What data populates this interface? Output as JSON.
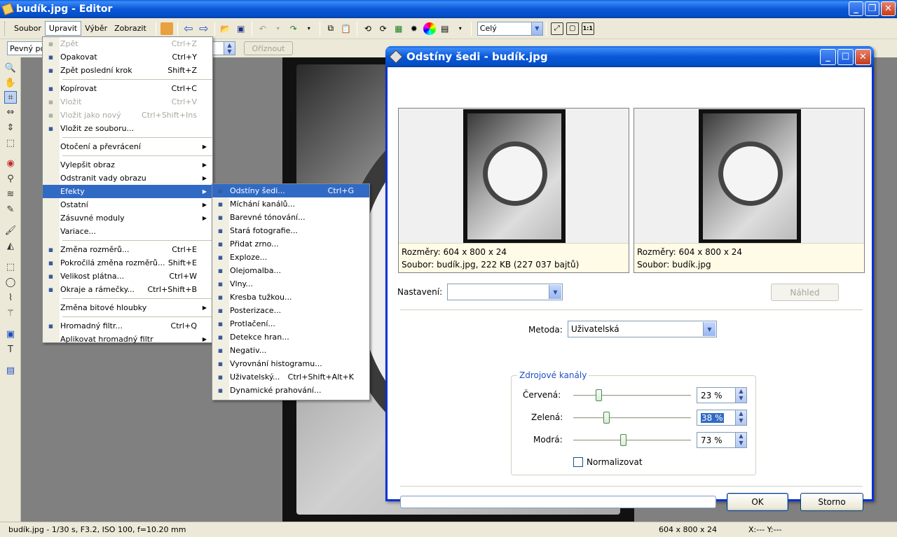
{
  "window": {
    "title": "budík.jpg - Editor"
  },
  "menubar": [
    "Soubor",
    "Upravit",
    "Výběr",
    "Zobrazit"
  ],
  "toolbar": {
    "zoom_value": "Celý",
    "ratio_value": "Pevný po",
    "crop_button": "Oříznout"
  },
  "edit_menu": [
    {
      "label": "Zpět",
      "shortcut": "Ctrl+Z",
      "icon": "undo-icon",
      "disabled": true
    },
    {
      "label": "Opakovat",
      "shortcut": "Ctrl+Y",
      "icon": "redo-icon"
    },
    {
      "label": "Zpět poslední krok",
      "shortcut": "Shift+Z",
      "icon": "undo-last-icon"
    },
    {
      "sep": true
    },
    {
      "label": "Kopírovat",
      "shortcut": "Ctrl+C",
      "icon": "copy-icon"
    },
    {
      "label": "Vložit",
      "shortcut": "Ctrl+V",
      "icon": "paste-icon",
      "disabled": true
    },
    {
      "label": "Vložit jako nový",
      "shortcut": "Ctrl+Shift+Ins",
      "icon": "paste-new-icon",
      "disabled": true
    },
    {
      "label": "Vložit ze souboru...",
      "shortcut": "",
      "icon": "paste-file-icon"
    },
    {
      "sep": true
    },
    {
      "label": "Otočení a převrácení",
      "submenu": true
    },
    {
      "sep": true
    },
    {
      "label": "Vylepšit obraz",
      "submenu": true
    },
    {
      "label": "Odstranit vady obrazu",
      "submenu": true
    },
    {
      "label": "Efekty",
      "submenu": true,
      "highlighted": true
    },
    {
      "label": "Ostatní",
      "submenu": true
    },
    {
      "label": "Zásuvné moduly",
      "submenu": true
    },
    {
      "label": "Variace...",
      "shortcut": ""
    },
    {
      "sep": true
    },
    {
      "label": "Změna rozměrů...",
      "shortcut": "Ctrl+E",
      "icon": "resize-icon"
    },
    {
      "label": "Pokročilá změna rozměrů...",
      "shortcut": "Shift+E",
      "icon": "advanced-resize-icon"
    },
    {
      "label": "Velikost plátna...",
      "shortcut": "Ctrl+W",
      "icon": "canvas-size-icon"
    },
    {
      "label": "Okraje a rámečky...",
      "shortcut": "Ctrl+Shift+B",
      "icon": "border-icon"
    },
    {
      "sep": true
    },
    {
      "label": "Změna bitové hloubky",
      "submenu": true
    },
    {
      "sep": true
    },
    {
      "label": "Hromadný filtr...",
      "shortcut": "Ctrl+Q",
      "icon": "batch-filter-icon"
    },
    {
      "label": "Aplikovat hromadný filtr",
      "submenu": true
    }
  ],
  "effects_menu": [
    {
      "label": "Odstíny šedi...",
      "shortcut": "Ctrl+G",
      "icon": "grayscale-icon",
      "highlighted": true
    },
    {
      "label": "Míchání kanálů...",
      "icon": "channel-mixer-icon"
    },
    {
      "label": "Barevné tónování...",
      "icon": "color-toning-icon"
    },
    {
      "label": "Stará fotografie...",
      "icon": "old-photo-icon"
    },
    {
      "label": "Přidat zrno...",
      "icon": "grain-icon"
    },
    {
      "label": "Exploze...",
      "icon": "explosion-icon"
    },
    {
      "label": "Olejomalba...",
      "icon": "oil-paint-icon"
    },
    {
      "label": "Vlny...",
      "icon": "waves-icon"
    },
    {
      "label": "Kresba tužkou...",
      "icon": "pencil-icon"
    },
    {
      "label": "Posterizace...",
      "icon": "posterize-icon"
    },
    {
      "label": "Protlačení...",
      "icon": "emboss-icon"
    },
    {
      "label": "Detekce hran...",
      "icon": "edge-detect-icon"
    },
    {
      "label": "Negativ...",
      "icon": "negative-icon"
    },
    {
      "label": "Vyrovnání histogramu...",
      "icon": "histogram-icon"
    },
    {
      "label": "Uživatelský...",
      "shortcut": "Ctrl+Shift+Alt+K",
      "icon": "custom-filter-icon"
    },
    {
      "label": "Dynamické prahování...",
      "icon": "threshold-icon"
    }
  ],
  "dialog": {
    "title": "Odstíny šedi - budík.jpg",
    "preview_left": {
      "dims": "Rozměry: 604 x 800 x 24",
      "file": "Soubor: budík.jpg, 222 KB (227 037 bajtů)"
    },
    "preview_right": {
      "dims": "Rozměry: 604 x 800 x 24",
      "file": "Soubor: budík.jpg"
    },
    "settings_label": "Nastavení:",
    "settings_value": "",
    "preview_button": "Náhled",
    "method_label": "Metoda:",
    "method_value": "Uživatelská",
    "channels_title": "Zdrojové kanály",
    "channels": [
      {
        "label": "Červená:",
        "value": "23 %",
        "level": 0.23
      },
      {
        "label": "Zelená:",
        "value": "38 %",
        "level": 0.38,
        "selected": true
      },
      {
        "label": "Modrá:",
        "value": "73 %",
        "level": 0.73
      }
    ],
    "normalize_label": "Normalizovat",
    "ok_button": "OK",
    "cancel_button": "Storno"
  },
  "statusbar": {
    "exif": "budík.jpg - 1/30 s, F3.2, ISO 100, f=10.20 mm",
    "dims": "604 x 800 x 24",
    "coords": "X:--- Y:---"
  }
}
